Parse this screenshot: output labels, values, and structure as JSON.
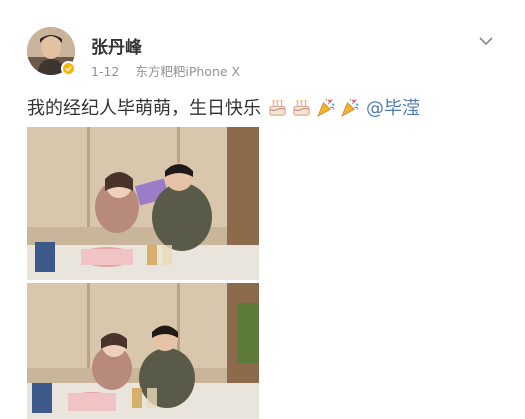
{
  "post": {
    "author": {
      "name": "张丹峰",
      "verified": true
    },
    "date": "1-12",
    "source": "东方粑粑iPhone X",
    "text": "我的经纪人毕萌萌，生日快乐",
    "emojis": [
      "cake-emoji",
      "cake-emoji",
      "party-popper-emoji",
      "party-popper-emoji"
    ],
    "mention": "@毕滢",
    "photos": [
      {
        "description_icon": "photo-birthday-party-1"
      },
      {
        "description_icon": "photo-birthday-party-2"
      }
    ]
  },
  "colors": {
    "username": "#333333",
    "meta": "#939393",
    "text": "#333333",
    "mention": "#507daf",
    "verify_badge": "#f7b500"
  }
}
